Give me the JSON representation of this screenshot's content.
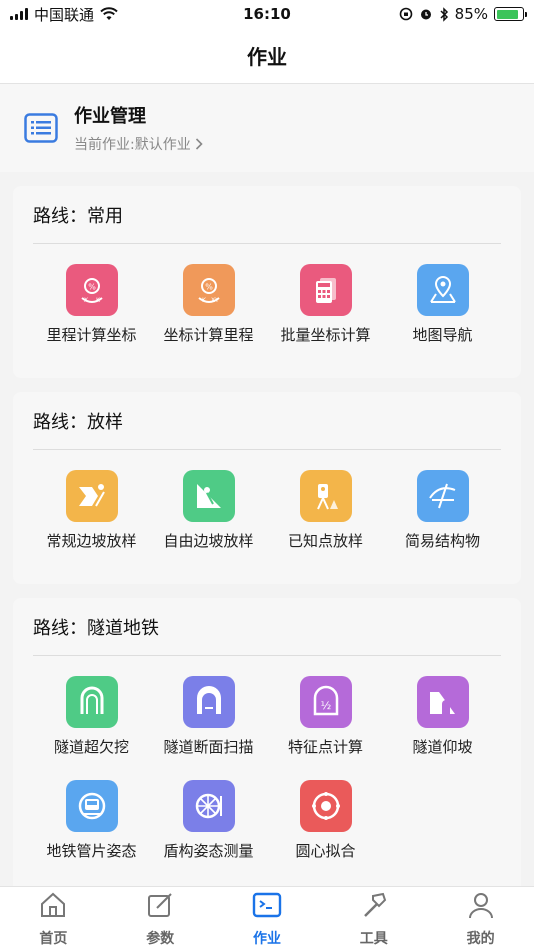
{
  "status_bar": {
    "carrier": "中国联通",
    "time": "16:10",
    "battery_percent": "85%",
    "battery_level": 0.85
  },
  "nav": {
    "title": "作业"
  },
  "manage": {
    "title": "作业管理",
    "subtitle": "当前作业:默认作业"
  },
  "sections": [
    {
      "title": "路线：常用",
      "tools": [
        {
          "label": "里程计算坐标",
          "icon": "mileage-to-coord-icon",
          "color": "#ea5a7e"
        },
        {
          "label": "坐标计算里程",
          "icon": "coord-to-mileage-icon",
          "color": "#f0995a"
        },
        {
          "label": "批量坐标计算",
          "icon": "batch-calc-icon",
          "color": "#ea5a7e"
        },
        {
          "label": "地图导航",
          "icon": "map-nav-icon",
          "color": "#5aa6ef"
        }
      ]
    },
    {
      "title": "路线：放样",
      "tools": [
        {
          "label": "常规边坡放样",
          "icon": "slope-stakeout-icon",
          "color": "#f3b54a"
        },
        {
          "label": "自由边坡放样",
          "icon": "free-slope-icon",
          "color": "#4fcb86"
        },
        {
          "label": "已知点放样",
          "icon": "known-point-icon",
          "color": "#f3b54a"
        },
        {
          "label": "简易结构物",
          "icon": "simple-structure-icon",
          "color": "#5aa6ef"
        }
      ]
    },
    {
      "title": "路线：隧道地铁",
      "tools": [
        {
          "label": "隧道超欠挖",
          "icon": "tunnel-overbreak-icon",
          "color": "#4fcb86"
        },
        {
          "label": "隧道断面扫描",
          "icon": "tunnel-scan-icon",
          "color": "#7b7fe8"
        },
        {
          "label": "特征点计算",
          "icon": "feature-point-icon",
          "color": "#b56ad9"
        },
        {
          "label": "隧道仰坡",
          "icon": "tunnel-slope-icon",
          "color": "#b56ad9"
        },
        {
          "label": "地铁管片姿态",
          "icon": "metro-segment-icon",
          "color": "#5aa6ef"
        },
        {
          "label": "盾构姿态测量",
          "icon": "shield-attitude-icon",
          "color": "#7b7fe8"
        },
        {
          "label": "圆心拟合",
          "icon": "circle-fit-icon",
          "color": "#ea5a5a"
        }
      ]
    }
  ],
  "tabs": [
    {
      "label": "首页",
      "icon": "home-icon",
      "active": false
    },
    {
      "label": "参数",
      "icon": "edit-icon",
      "active": false
    },
    {
      "label": "作业",
      "icon": "terminal-icon",
      "active": true
    },
    {
      "label": "工具",
      "icon": "hammer-icon",
      "active": false
    },
    {
      "label": "我的",
      "icon": "user-icon",
      "active": false
    }
  ],
  "colors": {
    "accent": "#1a73e8",
    "manage_icon": "#3a7be0"
  }
}
